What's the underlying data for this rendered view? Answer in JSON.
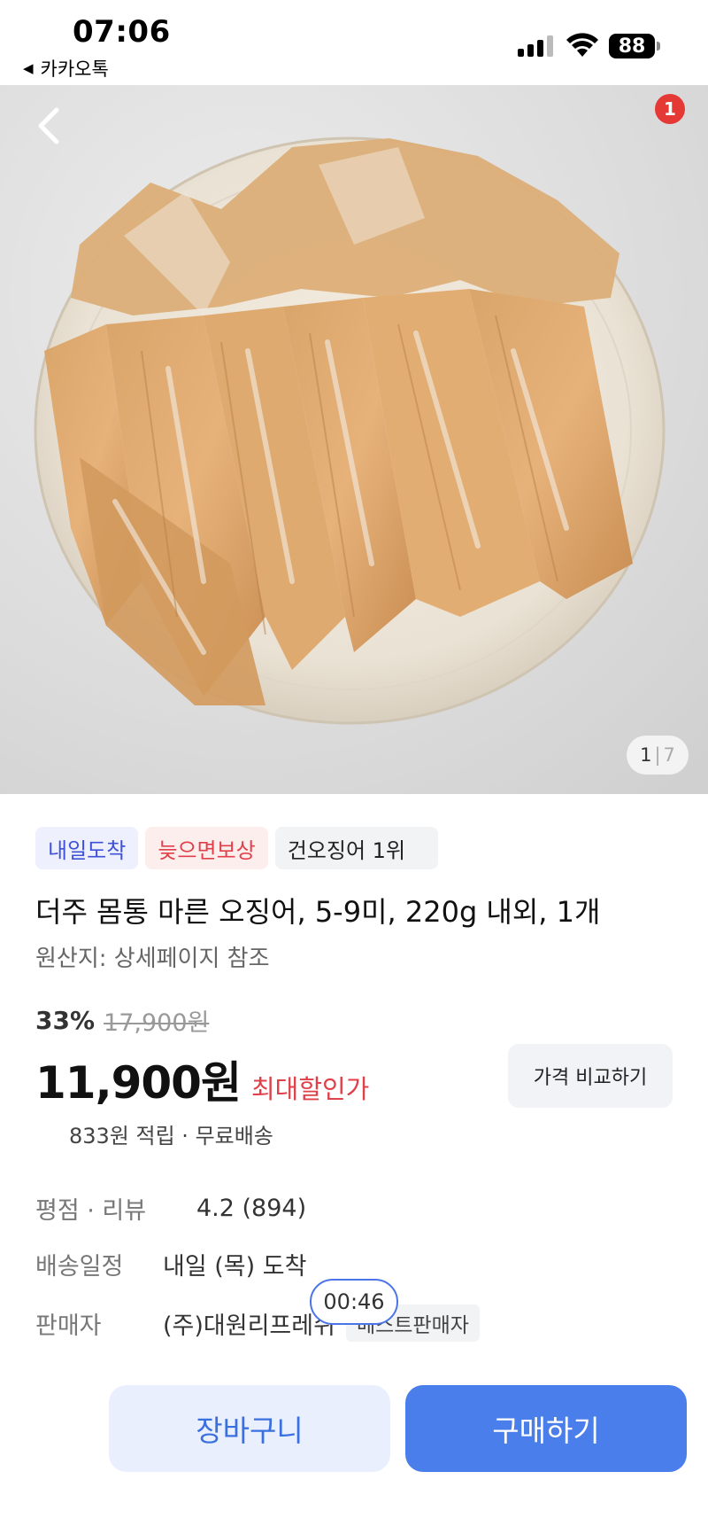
{
  "status_bar": {
    "time": "07:06",
    "back_app": "카카오톡",
    "battery": "88"
  },
  "hero": {
    "image_description": "dried-squid-on-plate",
    "cart_badge_count": "1",
    "counter_current": "1",
    "counter_separator": "|",
    "counter_total": "7"
  },
  "tags": {
    "arrival": "내일도착",
    "late_comp": "늦으면보상",
    "rank": "건오징어 1위"
  },
  "product": {
    "title": "더주 몸통 마른 오징어, 5-9미, 220g 내외, 1개",
    "origin": "원산지: 상세페이지 참조",
    "discount_rate": "33%",
    "original_price": "17,900원",
    "price": "11,900원",
    "max_discount_label": "최대할인가",
    "compare_label": "가격 비교하기",
    "points_shipping": "833원 적립 · 무료배송"
  },
  "info": {
    "rating_label": "평점 · 리뷰",
    "rating_value": "4.2 (894)",
    "shipping_label": "배송일정",
    "shipping_value": "내일 (목) 도착",
    "seller_label": "판매자",
    "seller_value": "(주)대원리프레쉬",
    "seller_badge": "베스트판매자"
  },
  "overlay": {
    "timer": "00:46"
  },
  "actions": {
    "cart": "장바구니",
    "buy": "구매하기"
  },
  "colors": {
    "accent_blue": "#4a7eea",
    "discount_red": "#e0404a",
    "badge_red": "#e53935"
  }
}
